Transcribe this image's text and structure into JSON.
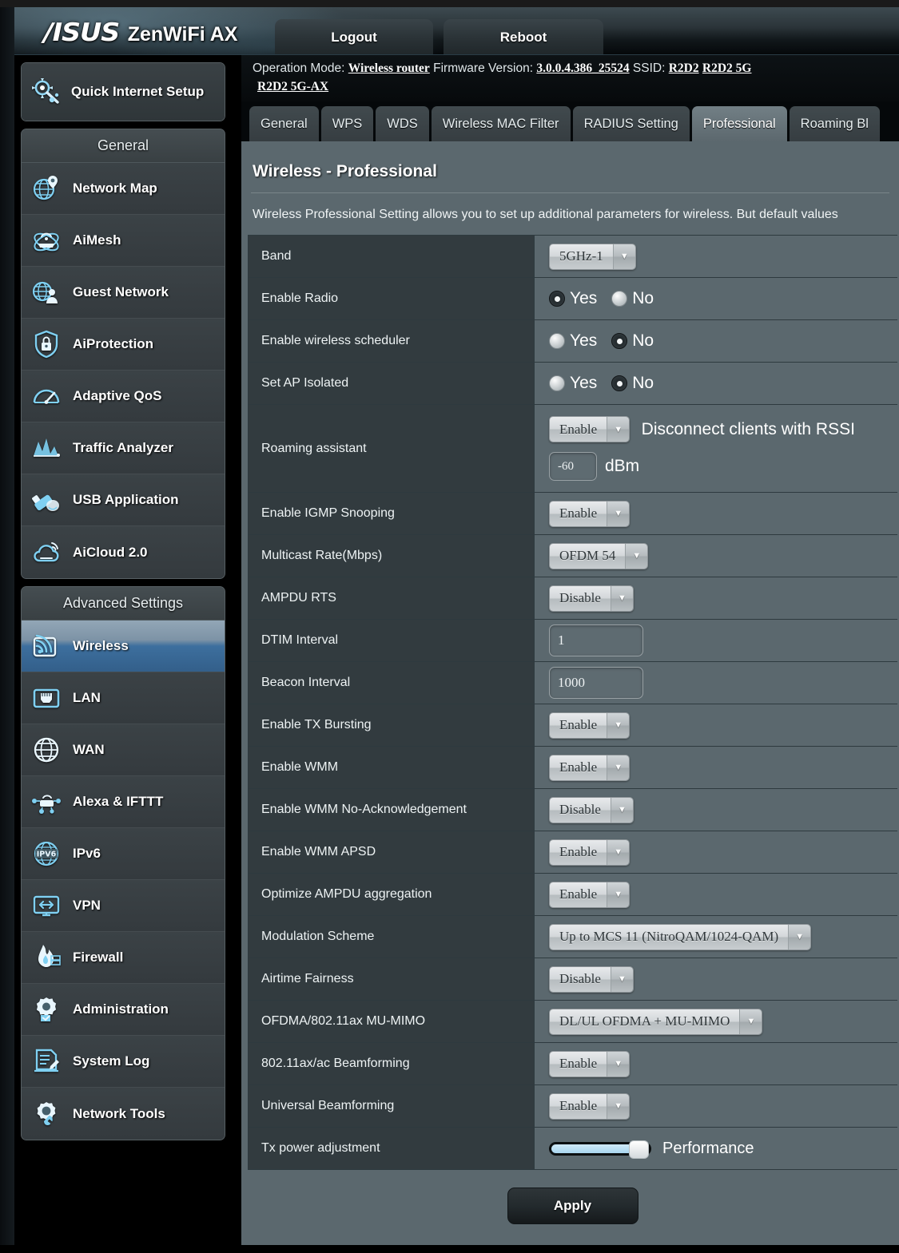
{
  "header": {
    "brand": "/ISUS",
    "model": "ZenWiFi AX",
    "logout_label": "Logout",
    "reboot_label": "Reboot"
  },
  "infobar": {
    "operation_mode_label": "Operation Mode:",
    "operation_mode_value": "Wireless router",
    "firmware_label": "Firmware Version:",
    "firmware_value": "3.0.0.4.386_25524",
    "ssid_label": "SSID:",
    "ssid_1": "R2D2",
    "ssid_2": "R2D2 5G",
    "ssid_3": "R2D2 5G-AX"
  },
  "sidebar": {
    "quick_setup": "Quick Internet Setup",
    "general_header": "General",
    "general_items": [
      {
        "label": "Network Map",
        "icon": "network-map-icon"
      },
      {
        "label": "AiMesh",
        "icon": "aimesh-icon"
      },
      {
        "label": "Guest Network",
        "icon": "guest-network-icon"
      },
      {
        "label": "AiProtection",
        "icon": "shield-lock-icon"
      },
      {
        "label": "Adaptive QoS",
        "icon": "gauge-icon"
      },
      {
        "label": "Traffic Analyzer",
        "icon": "traffic-chart-icon"
      },
      {
        "label": "USB Application",
        "icon": "usb-icon"
      },
      {
        "label": "AiCloud 2.0",
        "icon": "cloud-icon"
      }
    ],
    "advanced_header": "Advanced Settings",
    "advanced_items": [
      {
        "label": "Wireless",
        "icon": "wireless-icon",
        "active": true
      },
      {
        "label": "LAN",
        "icon": "lan-port-icon",
        "active": false
      },
      {
        "label": "WAN",
        "icon": "globe-icon",
        "active": false
      },
      {
        "label": "Alexa & IFTTT",
        "icon": "alexa-ifttt-icon",
        "active": false
      },
      {
        "label": "IPv6",
        "icon": "ipv6-icon",
        "active": false
      },
      {
        "label": "VPN",
        "icon": "vpn-icon",
        "active": false
      },
      {
        "label": "Firewall",
        "icon": "firewall-flame-icon",
        "active": false
      },
      {
        "label": "Administration",
        "icon": "administration-gear-icon",
        "active": false
      },
      {
        "label": "System Log",
        "icon": "system-log-icon",
        "active": false
      },
      {
        "label": "Network Tools",
        "icon": "network-tools-icon",
        "active": false
      }
    ]
  },
  "tabs": [
    {
      "label": "General",
      "active": false
    },
    {
      "label": "WPS",
      "active": false
    },
    {
      "label": "WDS",
      "active": false
    },
    {
      "label": "Wireless MAC Filter",
      "active": false
    },
    {
      "label": "RADIUS Setting",
      "active": false
    },
    {
      "label": "Professional",
      "active": true
    },
    {
      "label": "Roaming Bl",
      "active": false
    }
  ],
  "page": {
    "title": "Wireless - Professional",
    "description": "Wireless Professional Setting allows you to set up additional parameters for wireless. But default values"
  },
  "rows": {
    "band": {
      "label": "Band",
      "value": "5GHz-1"
    },
    "enable_radio": {
      "label": "Enable Radio",
      "yes": "Yes",
      "no": "No",
      "selected": "Yes"
    },
    "wireless_scheduler": {
      "label": "Enable wireless scheduler",
      "yes": "Yes",
      "no": "No",
      "selected": "No"
    },
    "ap_isolated": {
      "label": "Set AP Isolated",
      "yes": "Yes",
      "no": "No",
      "selected": "No"
    },
    "roaming_assistant": {
      "label": "Roaming assistant",
      "value": "Enable",
      "text_after": "Disconnect clients with RSSI",
      "rssi_value": "-60",
      "unit": "dBm"
    },
    "igmp_snooping": {
      "label": "Enable IGMP Snooping",
      "value": "Enable"
    },
    "multicast_rate": {
      "label": "Multicast Rate(Mbps)",
      "value": "OFDM 54"
    },
    "ampdu_rts": {
      "label": "AMPDU RTS",
      "value": "Disable"
    },
    "dtim_interval": {
      "label": "DTIM Interval",
      "value": "1"
    },
    "beacon_interval": {
      "label": "Beacon Interval",
      "value": "1000"
    },
    "tx_bursting": {
      "label": "Enable TX Bursting",
      "value": "Enable"
    },
    "wmm": {
      "label": "Enable WMM",
      "value": "Enable"
    },
    "wmm_no_ack": {
      "label": "Enable WMM No-Acknowledgement",
      "value": "Disable"
    },
    "wmm_apsd": {
      "label": "Enable WMM APSD",
      "value": "Enable"
    },
    "optimize_ampdu": {
      "label": "Optimize AMPDU aggregation",
      "value": "Enable"
    },
    "modulation_scheme": {
      "label": "Modulation Scheme",
      "value": "Up to MCS 11 (NitroQAM/1024-QAM)"
    },
    "airtime_fairness": {
      "label": "Airtime Fairness",
      "value": "Disable"
    },
    "ofdma_mumimo": {
      "label": "OFDMA/802.11ax MU-MIMO",
      "value": "DL/UL OFDMA + MU-MIMO"
    },
    "ax_ac_beamforming": {
      "label": "802.11ax/ac Beamforming",
      "value": "Enable"
    },
    "universal_beamforming": {
      "label": "Universal Beamforming",
      "value": "Enable"
    },
    "tx_power": {
      "label": "Tx power adjustment",
      "mode": "Performance",
      "percent": 82
    }
  },
  "footer": {
    "apply_label": "Apply"
  },
  "colors": {
    "accent_blue": "#3d6f9e",
    "content_bg": "#5b686e",
    "label_bg": "#323b3f",
    "icon_blue": "#7fd0f2"
  }
}
